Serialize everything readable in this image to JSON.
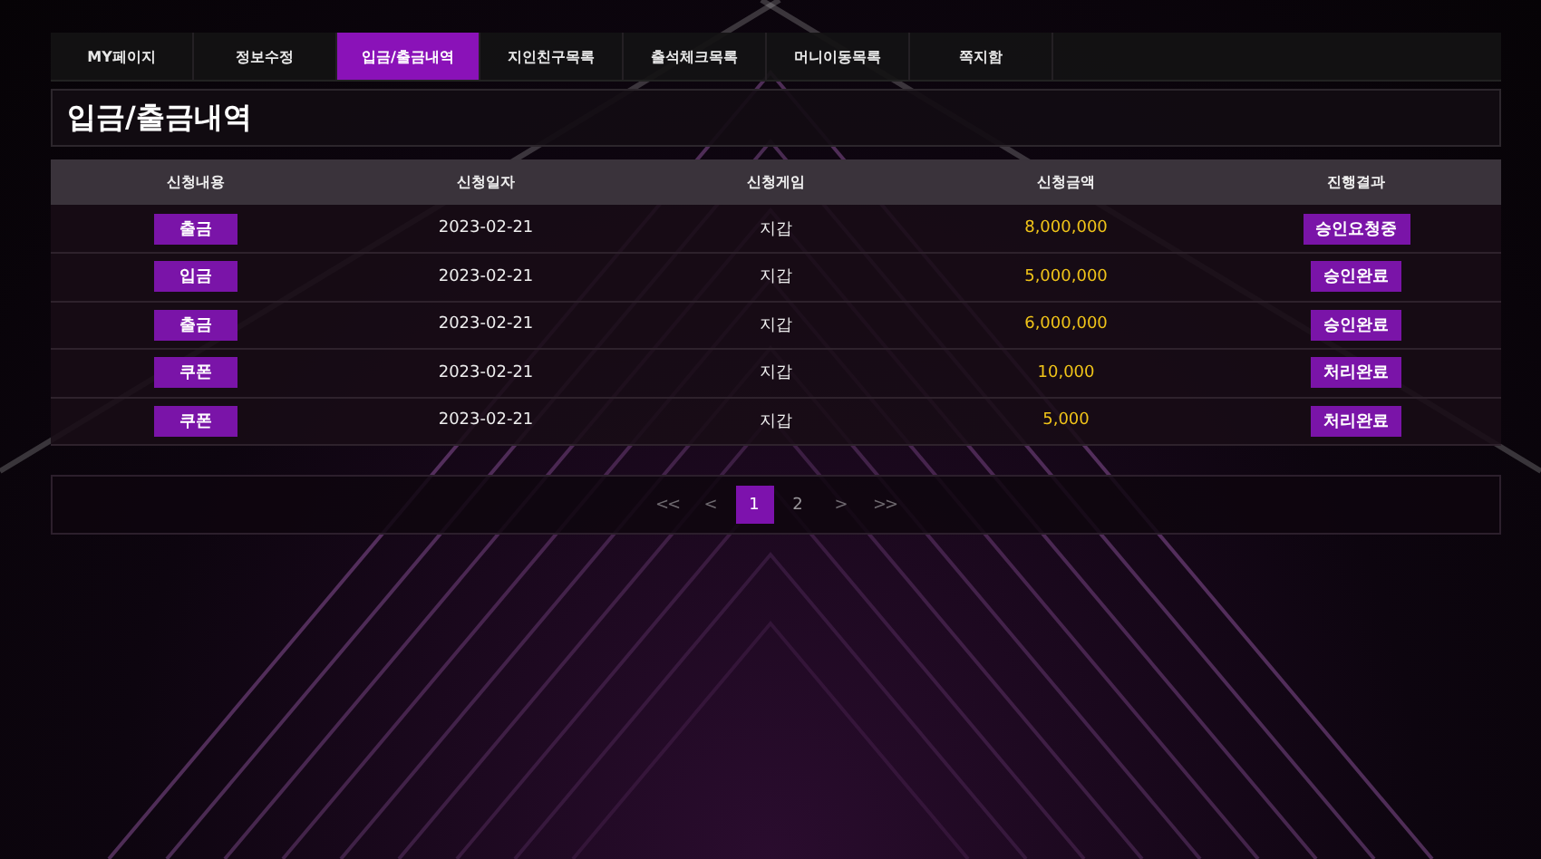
{
  "tabs": [
    {
      "label": "MY페이지",
      "selected": false
    },
    {
      "label": "정보수정",
      "selected": false
    },
    {
      "label": "입금/출금내역",
      "selected": true
    },
    {
      "label": "지인친구목록",
      "selected": false
    },
    {
      "label": "출석체크목록",
      "selected": false
    },
    {
      "label": "머니이동목록",
      "selected": false
    },
    {
      "label": "쪽지함",
      "selected": false
    }
  ],
  "page_title": "입금/출금내역",
  "table": {
    "columns": [
      "신청내용",
      "신청일자",
      "신청게임",
      "신청금액",
      "진행결과"
    ],
    "rows": [
      {
        "type": "출금",
        "date": "2023-02-21",
        "game": "지갑",
        "amount": "8,000,000",
        "result": "승인요청중"
      },
      {
        "type": "입금",
        "date": "2023-02-21",
        "game": "지갑",
        "amount": "5,000,000",
        "result": "승인완료"
      },
      {
        "type": "출금",
        "date": "2023-02-21",
        "game": "지갑",
        "amount": "6,000,000",
        "result": "승인완료"
      },
      {
        "type": "쿠폰",
        "date": "2023-02-21",
        "game": "지갑",
        "amount": "10,000",
        "result": "처리완료"
      },
      {
        "type": "쿠폰",
        "date": "2023-02-21",
        "game": "지갑",
        "amount": "5,000",
        "result": "처리완료"
      }
    ]
  },
  "pagination": [
    {
      "kind": "first",
      "label": "<<",
      "selected": false
    },
    {
      "kind": "prev",
      "label": "<",
      "selected": false
    },
    {
      "kind": "page",
      "label": "1",
      "selected": true
    },
    {
      "kind": "page",
      "label": "2",
      "selected": false
    },
    {
      "kind": "next",
      "label": ">",
      "selected": false
    },
    {
      "kind": "last",
      "label": ">>",
      "selected": false
    }
  ]
}
